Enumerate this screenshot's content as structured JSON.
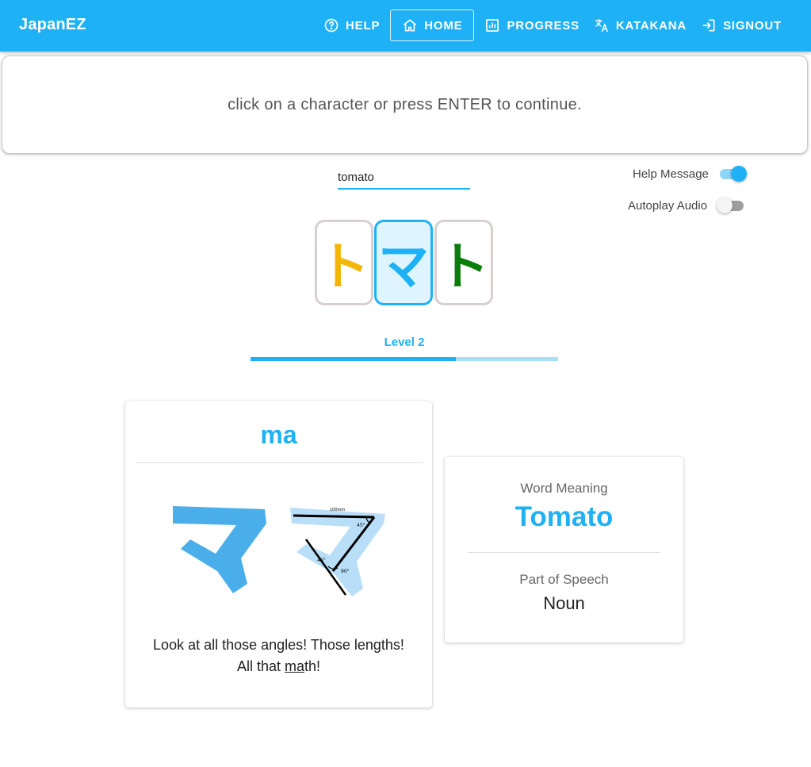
{
  "app": {
    "title": "JapanEZ"
  },
  "nav": {
    "help": "HELP",
    "home": "HOME",
    "progress": "PROGRESS",
    "katakana": "KATAKANA",
    "signout": "SIGNOUT"
  },
  "banner": {
    "message": "click on a character or press ENTER to continue."
  },
  "word_input": {
    "value": "tomato"
  },
  "settings": {
    "help_message": {
      "label": "Help Message",
      "enabled": true
    },
    "autoplay_audio": {
      "label": "Autoplay Audio",
      "enabled": false
    }
  },
  "characters": [
    {
      "glyph": "ト",
      "color": "#f2b705",
      "selected": false
    },
    {
      "glyph": "マ",
      "color": "#1eb1f5",
      "selected": true
    },
    {
      "glyph": "ト",
      "color": "#0b7d0b",
      "selected": false
    }
  ],
  "level": {
    "label": "Level 2",
    "progress": 0.667
  },
  "character_card": {
    "romaji": "ma",
    "mnemonic_before": "Look at all those angles! Those lengths! All that ",
    "mnemonic_highlight": "ma",
    "mnemonic_after": "th!",
    "diagram_labels": {
      "top": "100mm",
      "angle_top": "45°",
      "angle_left": "45°",
      "angle_bottom": "90°"
    }
  },
  "word_card": {
    "meaning_label": "Word Meaning",
    "meaning_value": "Tomato",
    "pos_label": "Part of Speech",
    "pos_value": "Noun"
  },
  "colors": {
    "accent": "#1eb1f5",
    "illustration": "#4aaeea",
    "illustration_light": "#b8def8"
  }
}
